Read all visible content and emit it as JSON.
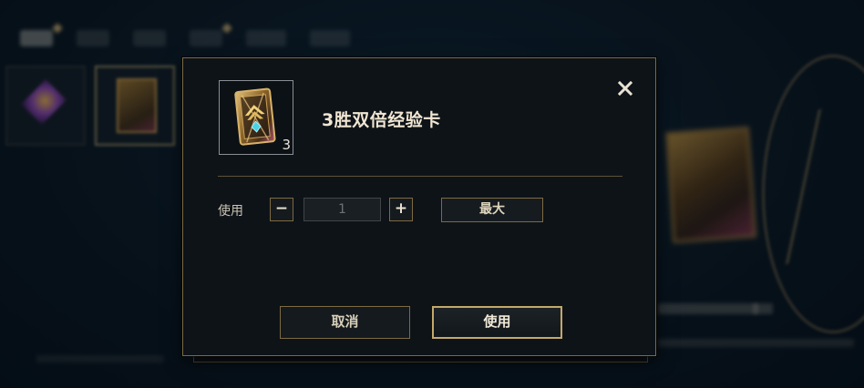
{
  "dialog": {
    "item_title": "3胜双倍经验卡",
    "item_count": "3",
    "use_label": "使用",
    "quantity_value": "1",
    "minus_symbol": "−",
    "plus_symbol": "+",
    "max_label": "最大",
    "cancel_label": "取消",
    "confirm_label": "使用",
    "close_icon": "close-icon",
    "item_icon": "double-xp-card-icon"
  },
  "colors": {
    "gold_border": "#c4a86a",
    "dialog_bg": "#0e1318",
    "title_text": "#f0e6d2"
  }
}
